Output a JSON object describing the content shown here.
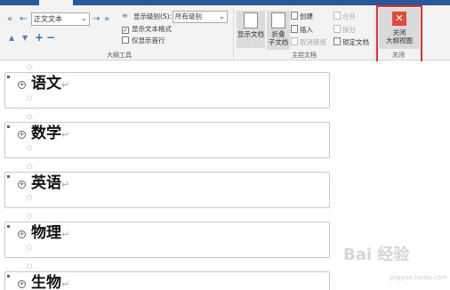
{
  "outline_tools": {
    "level_select_value": "正文文本",
    "show_level_label": "显示级别(S):",
    "show_level_value": "所有级别",
    "show_text_format_label": "显示文本格式",
    "show_text_format_checked": true,
    "show_first_line_only_label": "仅显示首行",
    "show_first_line_only_checked": false,
    "group_label": "大纲工具",
    "icons": [
      "promote-to-heading1-icon",
      "promote-icon",
      "demote-icon",
      "demote-to-body-icon",
      "move-up-icon",
      "move-down-icon",
      "expand-icon",
      "collapse-icon"
    ]
  },
  "master_document": {
    "show_document_label": "显示文档",
    "collapse_subdocs_label": "折叠\n子文档",
    "create_label": "创建",
    "insert_label": "插入",
    "unlink_label": "取消链接",
    "merge_label": "合并",
    "split_label": "拆分",
    "lock_document_label": "锁定文档",
    "group_label": "主控文档"
  },
  "close_group": {
    "close_button_label": "关闭\n大纲视图",
    "group_label": "关闭"
  },
  "headings": [
    "语文",
    "数学",
    "英语",
    "物理",
    "生物"
  ],
  "paragraph_mark": "↵",
  "watermark": {
    "text": "Bai 经验",
    "sub": "jingyan.baidu.com"
  },
  "colors": {
    "title_bar": "#2b579a",
    "close_red": "#e24b3b",
    "highlight_red": "#e03030",
    "arrow_blue": "#2e75b6"
  }
}
